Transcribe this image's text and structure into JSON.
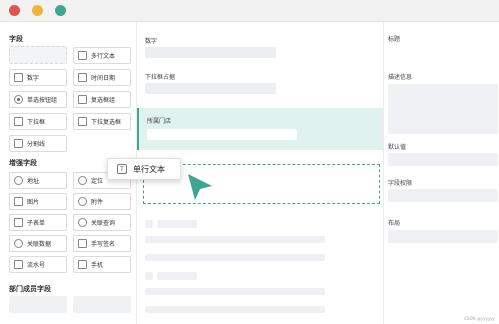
{
  "window": {
    "traffic_lights": [
      "#e0554e",
      "#f0b43a",
      "#3fa592"
    ]
  },
  "sidebar": {
    "section_fields": "字段",
    "fields": [
      {
        "label": "",
        "icon": ""
      },
      {
        "label": "多行文本",
        "icon": "multiline-text-icon"
      },
      {
        "label": "数字",
        "icon": "number-icon"
      },
      {
        "label": "时间日期",
        "icon": "calendar-icon"
      },
      {
        "label": "单选按钮组",
        "icon": "radio-icon"
      },
      {
        "label": "复选框组",
        "icon": "checkbox-icon"
      },
      {
        "label": "下拉框",
        "icon": "dropdown-icon"
      },
      {
        "label": "下拉复选框",
        "icon": "dropdown-checkbox-icon"
      },
      {
        "label": "分割线",
        "icon": "divider-icon"
      }
    ],
    "section_enhanced": "增强字段",
    "enhanced": [
      {
        "label": "地址",
        "icon": "location-icon"
      },
      {
        "label": "定位",
        "icon": "locate-icon"
      },
      {
        "label": "图片",
        "icon": "image-icon"
      },
      {
        "label": "附件",
        "icon": "attachment-icon"
      },
      {
        "label": "子表单",
        "icon": "subform-icon"
      },
      {
        "label": "关联查询",
        "icon": "link-query-icon"
      },
      {
        "label": "关联数据",
        "icon": "link-data-icon"
      },
      {
        "label": "手写签名",
        "icon": "signature-icon"
      },
      {
        "label": "流水号",
        "icon": "serial-icon"
      },
      {
        "label": "手机",
        "icon": "phone-icon"
      }
    ],
    "section_dept": "部门成员字段"
  },
  "canvas": {
    "field_number": "数字",
    "field_dropdown": "下拉框占据",
    "field_store": "所属门店"
  },
  "dragging": {
    "label": "单行文本",
    "icon": "text-field-icon"
  },
  "properties": {
    "title": "标题",
    "description": "描述信息",
    "default": "默认值",
    "permission": "字段权限",
    "layout": "布局"
  },
  "watermark": "CSDN @yyyyyy"
}
